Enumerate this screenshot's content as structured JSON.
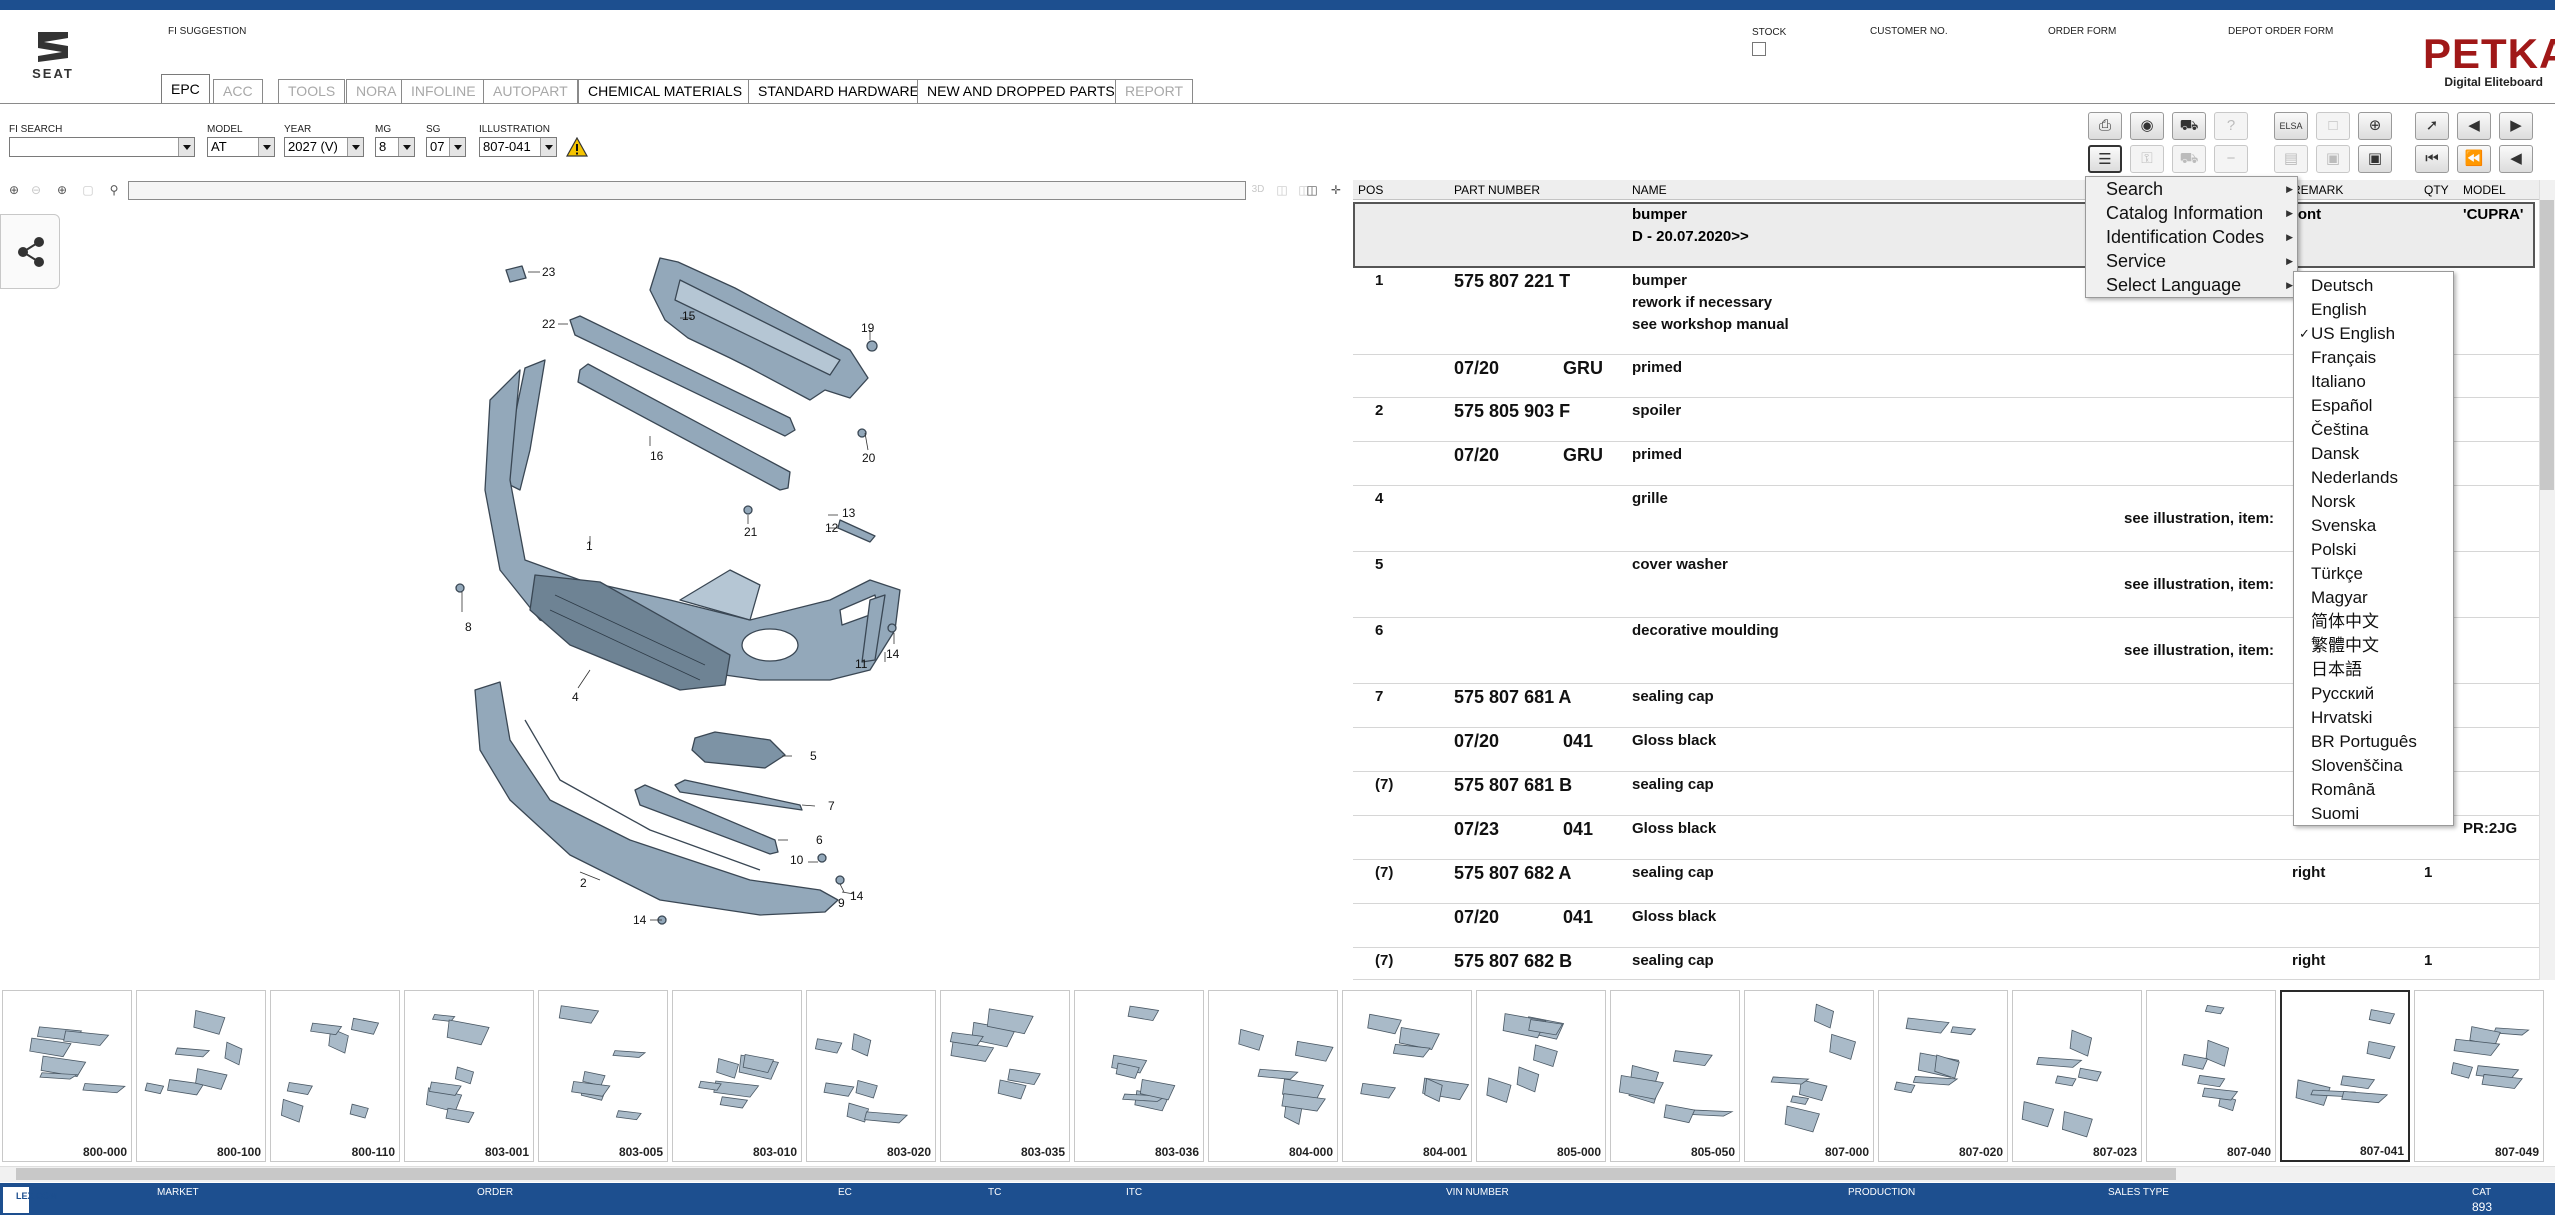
{
  "header": {
    "brand_left": "SEAT",
    "fi_suggestion_label": "FI SUGGESTION",
    "stock_label": "STOCK",
    "customer_no_label": "CUSTOMER NO.",
    "order_form_label": "ORDER FORM",
    "depot_order_form_label": "DEPOT ORDER FORM",
    "brand_right": "PETKA",
    "brand_right_sub": "Digital Eliteboard"
  },
  "tabs": [
    {
      "label": "EPC",
      "state": "active"
    },
    {
      "label": "ACC",
      "state": "disabled"
    },
    {
      "label": "TOOLS",
      "state": "disabled"
    },
    {
      "label": "NORA",
      "state": "disabled"
    },
    {
      "label": "INFOLINE",
      "state": "disabled"
    },
    {
      "label": "AUTOPART",
      "state": "disabled"
    },
    {
      "label": "CHEMICAL MATERIALS",
      "state": "enabled"
    },
    {
      "label": "STANDARD HARDWARE",
      "state": "enabled"
    },
    {
      "label": "NEW AND DROPPED PARTS",
      "state": "enabled"
    },
    {
      "label": "REPORT",
      "state": "disabled"
    }
  ],
  "filters": {
    "fi_search_label": "FI SEARCH",
    "fi_search_value": "",
    "model_label": "MODEL",
    "model_value": "AT",
    "year_label": "YEAR",
    "year_value": "2027 (V)",
    "mg_label": "MG",
    "mg_value": "8",
    "sg_label": "SG",
    "sg_value": "07",
    "illustration_label": "ILLUSTRATION",
    "illustration_value": "807-041"
  },
  "toolbar": {
    "btn_elsa": "ELSA",
    "btn_3d": "3D"
  },
  "table": {
    "columns": {
      "pos": "POS",
      "part_number": "PART NUMBER",
      "name": "NAME",
      "remark": "REMARK",
      "qty": "QTY",
      "model": "MODEL"
    },
    "header_row": {
      "name_line1": "bumper",
      "name_line2": "D - 20.07.2020>>",
      "remark": "ront",
      "model": "'CUPRA'"
    },
    "rows": [
      {
        "pos": "1",
        "part_number": "575 807 221 T",
        "name_lines": [
          "bumper",
          "rework if necessary",
          "see workshop manual"
        ],
        "remark": "",
        "qty": "",
        "model": "",
        "see": ""
      },
      {
        "pos": "",
        "part_number": "07/20",
        "color": "GRU",
        "name_lines": [
          "primed"
        ],
        "remark": "",
        "qty": "",
        "model": "",
        "see": ""
      },
      {
        "pos": "2",
        "part_number": "575 805 903 F",
        "name_lines": [
          "spoiler"
        ],
        "remark": "",
        "qty": "",
        "model": "",
        "see": ""
      },
      {
        "pos": "",
        "part_number": "07/20",
        "color": "GRU",
        "name_lines": [
          "primed"
        ],
        "remark": "",
        "qty": "",
        "model": "",
        "see": ""
      },
      {
        "pos": "4",
        "part_number": "",
        "name_lines": [
          "grille"
        ],
        "remark": "",
        "qty": "",
        "model": "",
        "see": "see illustration, item:"
      },
      {
        "pos": "5",
        "part_number": "",
        "name_lines": [
          "cover washer"
        ],
        "remark": "",
        "qty": "",
        "model": "",
        "see": "see illustration, item:"
      },
      {
        "pos": "6",
        "part_number": "",
        "name_lines": [
          "decorative moulding"
        ],
        "remark": "",
        "qty": "",
        "model": "",
        "see": "see illustration, item:"
      },
      {
        "pos": "7",
        "part_number": "575 807 681 A",
        "name_lines": [
          "sealing cap"
        ],
        "remark": "",
        "qty": "",
        "model": "",
        "see": ""
      },
      {
        "pos": "",
        "part_number": "07/20",
        "color": "041",
        "name_lines": [
          "Gloss black"
        ],
        "remark": "",
        "qty": "",
        "model": "",
        "see": ""
      },
      {
        "pos": "(7)",
        "part_number": "575 807 681 B",
        "name_lines": [
          "sealing cap"
        ],
        "remark": "",
        "qty": "",
        "model": "",
        "see": ""
      },
      {
        "pos": "",
        "part_number": "07/23",
        "color": "041",
        "name_lines": [
          "Gloss black"
        ],
        "remark": "",
        "qty": "",
        "model": "PR:2JG",
        "see": ""
      },
      {
        "pos": "(7)",
        "part_number": "575 807 682 A",
        "name_lines": [
          "sealing cap"
        ],
        "remark": "right",
        "qty": "1",
        "model": "",
        "see": ""
      },
      {
        "pos": "",
        "part_number": "07/20",
        "color": "041",
        "name_lines": [
          "Gloss black"
        ],
        "remark": "",
        "qty": "",
        "model": "",
        "see": ""
      },
      {
        "pos": "(7)",
        "part_number": "575 807 682 B",
        "name_lines": [
          "sealing cap"
        ],
        "remark": "right",
        "qty": "1",
        "model": "",
        "see": ""
      }
    ]
  },
  "context_menu": {
    "items": [
      "Search",
      "Catalog Information",
      "Identification Codes",
      "Service",
      "Select Language"
    ]
  },
  "language_menu": {
    "selected": "US English",
    "items": [
      "Deutsch",
      "English",
      "US English",
      "Français",
      "Italiano",
      "Español",
      "Čeština",
      "Dansk",
      "Nederlands",
      "Norsk",
      "Svenska",
      "Polski",
      "Türkçe",
      "Magyar",
      "简体中文",
      "繁體中文",
      "日本語",
      "Русский",
      "Hrvatski",
      "BR Português",
      "Slovenščina",
      "Română",
      "Suomi"
    ]
  },
  "illustration": {
    "callouts": [
      "23",
      "22",
      "15",
      "19",
      "16",
      "20",
      "13",
      "21",
      "12",
      "1",
      "8",
      "11",
      "14",
      "4",
      "5",
      "7",
      "6",
      "10",
      "2",
      "9",
      "14",
      "14"
    ]
  },
  "thumbnails": [
    {
      "label": "800-000"
    },
    {
      "label": "800-100"
    },
    {
      "label": "800-110"
    },
    {
      "label": "803-001"
    },
    {
      "label": "803-005"
    },
    {
      "label": "803-010"
    },
    {
      "label": "803-020"
    },
    {
      "label": "803-035"
    },
    {
      "label": "803-036"
    },
    {
      "label": "804-000"
    },
    {
      "label": "804-001"
    },
    {
      "label": "805-000"
    },
    {
      "label": "805-050"
    },
    {
      "label": "807-000"
    },
    {
      "label": "807-020"
    },
    {
      "label": "807-023"
    },
    {
      "label": "807-040"
    },
    {
      "label": "807-041",
      "selected": true
    },
    {
      "label": "807-049"
    }
  ],
  "statusbar": {
    "logo": "LEX COM",
    "market": "MARKET",
    "order": "ORDER",
    "ec": "EC",
    "tc": "TC",
    "itc": "ITC",
    "vin_number": "VIN NUMBER",
    "production": "PRODUCTION",
    "sales_type": "SALES TYPE",
    "cat_label": "CAT",
    "cat_value": "893"
  },
  "colors": {
    "brand_blue": "#1d4f8f",
    "part_gray": "#93a8ba"
  }
}
